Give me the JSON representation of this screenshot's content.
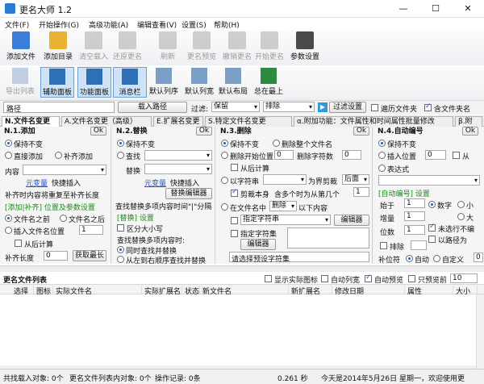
{
  "window": {
    "title": "更名大师 1.2",
    "min": "—",
    "max": "☐",
    "close": "✕"
  },
  "menu": [
    "文件(F)",
    "开始操作(G)",
    "高级功能(A)",
    "编辑查看(V)",
    "设置(S)",
    "帮助(H)"
  ],
  "toolbar1": [
    {
      "label": "添加文件",
      "color": "#3b7dd8",
      "enabled": true,
      "icon": "add-file-icon"
    },
    {
      "label": "添加目录",
      "color": "#e8b232",
      "enabled": true,
      "icon": "add-folder-icon"
    },
    {
      "label": "清空载入",
      "color": "#999999",
      "enabled": false,
      "icon": "clear-icon"
    },
    {
      "label": "还原更名",
      "color": "#999999",
      "enabled": false,
      "icon": "undo-rename-icon"
    },
    {
      "label": "刷新",
      "color": "#999999",
      "enabled": false,
      "icon": "refresh-icon"
    },
    {
      "label": "更名预览",
      "color": "#999999",
      "enabled": false,
      "icon": "preview-icon"
    },
    {
      "label": "撤销更名",
      "color": "#999999",
      "enabled": false,
      "icon": "trash-icon"
    },
    {
      "label": "开始更名",
      "color": "#999999",
      "enabled": false,
      "icon": "start-icon"
    },
    {
      "label": "参数设置",
      "color": "#4a4a4a",
      "enabled": true,
      "icon": "tools-icon"
    }
  ],
  "toolbar2": [
    {
      "label": "导出列表",
      "on": false,
      "enabled": false
    },
    {
      "label": "辅助面板",
      "on": true,
      "enabled": true
    },
    {
      "label": "功能面板",
      "on": true,
      "enabled": true
    },
    {
      "label": "消息栏",
      "on": true,
      "enabled": true
    },
    {
      "label": "默认列序",
      "on": false,
      "enabled": true
    },
    {
      "label": "默认列宽",
      "on": false,
      "enabled": true
    },
    {
      "label": "默认布局",
      "on": false,
      "enabled": true
    },
    {
      "label": "总在最上",
      "on": false,
      "enabled": true
    }
  ],
  "pathrow": {
    "path_label": "路径",
    "load_btn": "载入路径",
    "filter_label": "过滤:",
    "filter_mode": "保留",
    "filter_type": "排除",
    "filter_btn": "过滤设置",
    "opt1": "遍历文件夹",
    "opt2": "含文件夹名"
  },
  "tabs": [
    "N.文件名变更",
    "A.文件名变更（高级）",
    "E.扩展名变更",
    "S.特定文件名变更",
    "α.附加功能：文件属性和时间属性批量修改",
    "β.附"
  ],
  "p1": {
    "title": "N.1.添加",
    "ok": "Ok",
    "r1": "保持不变",
    "r2": "直接添加",
    "r3": "补齐添加",
    "content": "内容",
    "varlink": "元变量",
    "quick": "快捷插入",
    "pad_note": "补齐时内容将重复至补齐长度",
    "setting": "[添加|补齐] 位置及参数设置",
    "pos1": "文件名之前",
    "pos2": "文件名之后",
    "pos3": "插入文件名位置",
    "pos_val": "1",
    "fromend": "从后计算",
    "padlen": "补齐长度",
    "padval": "0",
    "getmax": "获取最长"
  },
  "p2": {
    "title": "N.2.替换",
    "ok": "Ok",
    "r1": "保持不变",
    "find": "查找",
    "replace": "替换",
    "varlink": "元变量",
    "quick": "快捷插入",
    "editor": "替换编辑器",
    "note": "查找替换多项内容时间\"|\"分隔",
    "regex": "[替换] 设置",
    "case": "区分大小写",
    "multi": "查找替换多项内容时:",
    "m1": "同时查找并替换",
    "m2": "从左到右顺序查找并替换"
  },
  "p3": {
    "title": "N.3.删除",
    "ok": "Ok",
    "r1": "保持不变",
    "r1b": "删除整个文件名",
    "r2": "删除开始位置",
    "v2": "0",
    "r2b": "删除字符数",
    "v2b": "0",
    "fromend": "从后计算",
    "r3": "以字符串",
    "r3b": "为界剪裁",
    "after": "后面",
    "cut": "剪裁本身",
    "contain": "含多个时为从第几个",
    "cval": "1",
    "r4": "在文件名中",
    "del": "删除",
    "r4b": "以下内容",
    "c1": "指定字符串",
    "editor": "编辑器",
    "c2": "指定字符集",
    "editor2": "编辑器",
    "preset": "请选择预设字符集"
  },
  "p4": {
    "title": "N.4.自动编号",
    "ok": "Ok",
    "r1": "保持不变",
    "r2": "插入位置",
    "v2": "0",
    "r2b": "从",
    "r3": "表达式",
    "setting": "[自动编号] 设置",
    "start": "始于",
    "sv": "1",
    "step": "增量",
    "stv": "1",
    "digits": "位数",
    "dv": "1",
    "num": "数字",
    "small": "小",
    "big": "大",
    "pad": "未选行不编",
    "path": "以路径为",
    "exclude": "排除",
    "fill": "补位符",
    "auto": "自动",
    "custom": "自定义",
    "cv": "0"
  },
  "list": {
    "title": "更名文件列表",
    "opt1": "显示实际图标",
    "opt2": "自动列宽",
    "opt3": "自动预览",
    "opt4": "只预览前",
    "n": "10",
    "cols": [
      "选择",
      "图标",
      "实际文件名",
      "实际扩展名",
      "状态",
      "新文件名",
      "新扩展名",
      "修改日期",
      "属性",
      "大小"
    ]
  },
  "status": {
    "a": "共找载入对象: 0个",
    "b": "更名文件列表内对象: 0个",
    "c": "操作记录: 0条",
    "d": "0.261 秒",
    "e": "今天是2014年5月26日 星期一，欢迎使用更"
  }
}
